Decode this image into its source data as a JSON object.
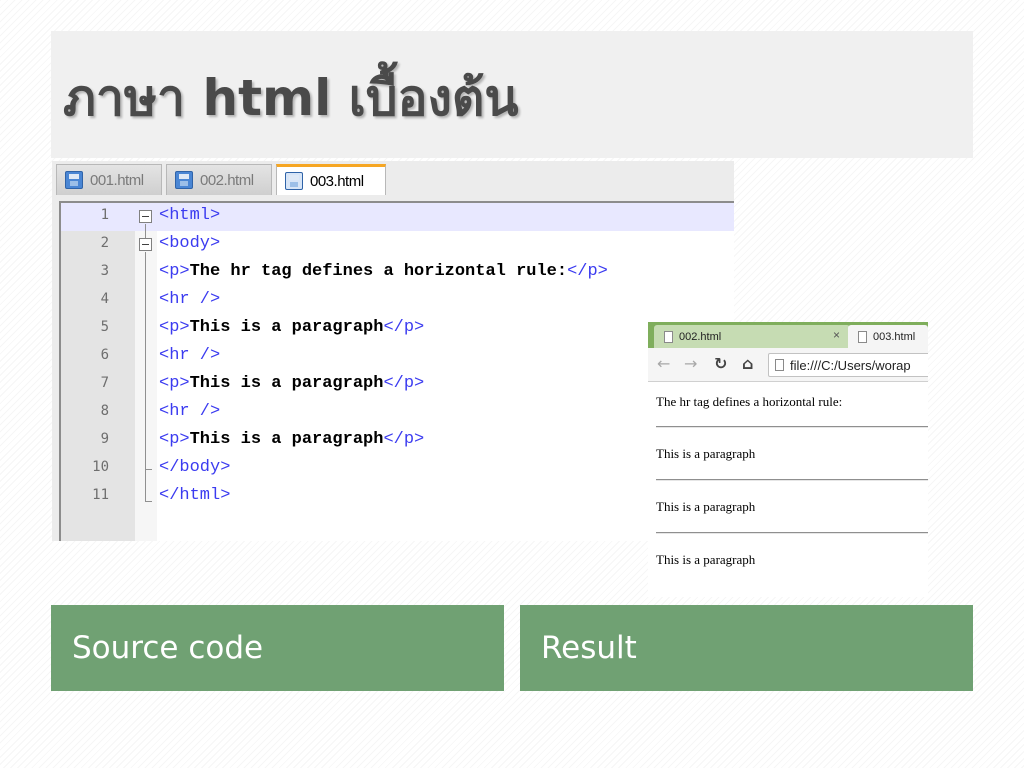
{
  "slide": {
    "title": "ภาษา html เบื้องต้น",
    "captions": {
      "left": "Source code",
      "right": "Result"
    }
  },
  "editor": {
    "tabs": [
      {
        "label": "001.html",
        "active": false
      },
      {
        "label": "002.html",
        "active": false
      },
      {
        "label": "003.html",
        "active": true
      }
    ],
    "lines": [
      {
        "num": "1",
        "parts": [
          {
            "t": "<html>",
            "k": "tag"
          }
        ]
      },
      {
        "num": "2",
        "parts": [
          {
            "t": "<body>",
            "k": "tag"
          }
        ]
      },
      {
        "num": "3",
        "parts": [
          {
            "t": "<p>",
            "k": "tag"
          },
          {
            "t": "The hr tag defines a horizontal rule:",
            "k": "text"
          },
          {
            "t": "</p>",
            "k": "tag"
          }
        ]
      },
      {
        "num": "4",
        "parts": [
          {
            "t": "<hr />",
            "k": "tag"
          }
        ]
      },
      {
        "num": "5",
        "parts": [
          {
            "t": "<p>",
            "k": "tag"
          },
          {
            "t": "This is a paragraph",
            "k": "text"
          },
          {
            "t": "</p>",
            "k": "tag"
          }
        ]
      },
      {
        "num": "6",
        "parts": [
          {
            "t": "<hr />",
            "k": "tag"
          }
        ]
      },
      {
        "num": "7",
        "parts": [
          {
            "t": "<p>",
            "k": "tag"
          },
          {
            "t": "This is a paragraph",
            "k": "text"
          },
          {
            "t": "</p>",
            "k": "tag"
          }
        ]
      },
      {
        "num": "8",
        "parts": [
          {
            "t": "<hr />",
            "k": "tag"
          }
        ]
      },
      {
        "num": "9",
        "parts": [
          {
            "t": "<p>",
            "k": "tag"
          },
          {
            "t": "This is a paragraph",
            "k": "text"
          },
          {
            "t": "</p>",
            "k": "tag"
          }
        ]
      },
      {
        "num": "10",
        "parts": [
          {
            "t": "</body>",
            "k": "tag"
          }
        ]
      },
      {
        "num": "11",
        "parts": [
          {
            "t": "</html>",
            "k": "tag"
          }
        ]
      }
    ]
  },
  "browser": {
    "tabs": [
      {
        "label": "002.html",
        "close": "×"
      },
      {
        "label": "003.html"
      }
    ],
    "address": "file:///C:/Users/worap",
    "content": [
      "The hr tag defines a horizontal rule:",
      "This is a paragraph",
      "This is a paragraph",
      "This is a paragraph"
    ]
  },
  "colors": {
    "caption_bg": "#70a173",
    "tag_blue": "#3b3bf0",
    "active_tab_accent": "#f6a623",
    "browser_tabbar": "#7fae5c"
  }
}
